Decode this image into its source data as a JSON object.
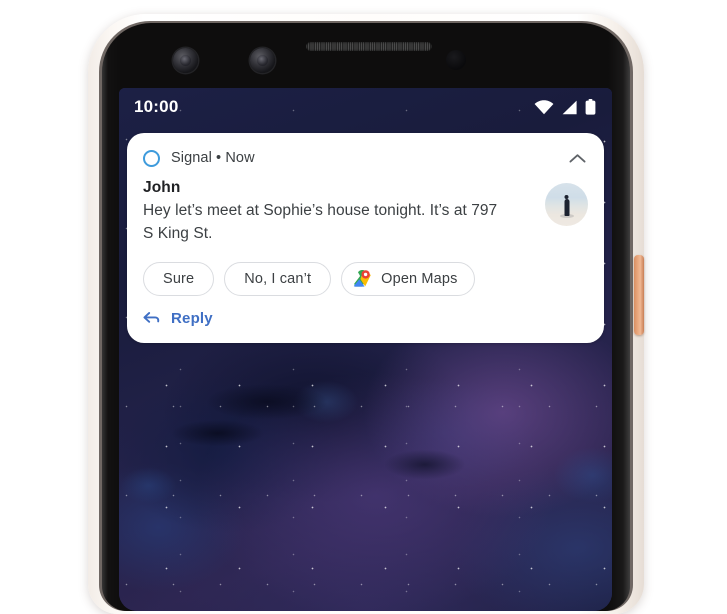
{
  "device": {
    "frame_color": "#fdfaf7",
    "bezel_color": "#0e0d0d",
    "power_button_color": "#e8a176",
    "sensors": {
      "camera_left": "front-camera-left",
      "camera_right": "front-camera-right",
      "earpiece": "earpiece-speaker",
      "proximity": "proximity-sensor"
    }
  },
  "screen": {
    "wallpaper_description": "dark navy and purple nebula marble with stars",
    "wallpaper_base_color": "#232447"
  },
  "status_bar": {
    "time": "10:00",
    "icons": [
      {
        "name": "wifi-icon",
        "label": "Wi-Fi"
      },
      {
        "name": "cellular-signal-icon",
        "label": "Cellular signal"
      },
      {
        "name": "battery-icon",
        "label": "Battery"
      }
    ],
    "text_color": "#ffffff"
  },
  "notification": {
    "app_icon": "signal-app-icon",
    "app_icon_color": "#3e9bdc",
    "app_name_row": "Signal • Now",
    "app_name": "Signal",
    "timestamp": "Now",
    "collapse_icon": "chevron-up-icon",
    "sender": "John",
    "message": "Hey let’s meet at Sophie’s house tonight. It’s at 797 S King St.",
    "avatar": "contact-avatar-photo",
    "actions": [
      {
        "label": "Sure",
        "icon": null
      },
      {
        "label": "No, I can’t",
        "icon": null
      },
      {
        "label": "Open Maps",
        "icon": "google-maps-icon"
      }
    ],
    "reply": {
      "label": "Reply",
      "icon": "reply-arrow-icon",
      "color": "#3f6fc4"
    },
    "card_color": "#ffffff"
  }
}
